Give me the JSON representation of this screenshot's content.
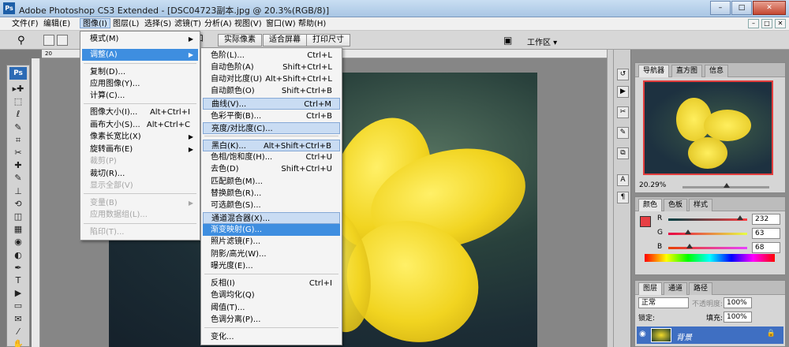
{
  "window": {
    "title": "Adobe Photoshop CS3 Extended - [DSC04723副本.jpg @ 20.3%(RGB/8)]",
    "app_badge": "Ps",
    "minimize": "–",
    "maximize": "□",
    "close": "✕"
  },
  "menubar": {
    "items": [
      "文件(F)",
      "编辑(E)",
      "图像(I)",
      "图层(L)",
      "选择(S)",
      "滤镜(T)",
      "分析(A)",
      "视图(V)",
      "窗口(W)",
      "帮助(H)"
    ],
    "active_index": 2,
    "doc_controls": [
      "–",
      "□",
      "✕"
    ]
  },
  "options_bar": {
    "tool_icon": "magnifier-icon",
    "buttons": [
      "实际像素",
      "适合屏幕",
      "打印尺寸"
    ],
    "partial_label": "口",
    "workspace": "工作区 ▾"
  },
  "toolbox": {
    "badge": "Ps",
    "tools": [
      "move-icon",
      "marquee-icon",
      "lasso-icon",
      "quick-select-icon",
      "crop-icon",
      "slice-icon",
      "healing-icon",
      "brush-icon",
      "clone-stamp-icon",
      "history-brush-icon",
      "eraser-icon",
      "gradient-icon",
      "blur-icon",
      "dodge-icon",
      "pen-icon",
      "type-icon",
      "path-select-icon",
      "shape-icon",
      "notes-icon",
      "eyedropper-icon",
      "hand-icon"
    ],
    "glyphs": [
      "▸✚",
      "⬚",
      "ℓ",
      "✎",
      "⌗",
      "✂",
      "✚",
      "✎",
      "⊥",
      "⟲",
      "◫",
      "▦",
      "◉",
      "◐",
      "✒",
      "T",
      "▶",
      "▭",
      "✉",
      "⁄",
      "✋"
    ]
  },
  "ruler": {
    "labels": [
      "20",
      "0"
    ]
  },
  "image_menu": {
    "items": [
      {
        "label": "模式(M)",
        "shortcut": "",
        "submenu": true,
        "disabled": false
      },
      {
        "label": "调整(A)",
        "shortcut": "",
        "submenu": true,
        "disabled": false,
        "selected": true
      },
      {
        "label": "复制(D)...",
        "shortcut": "",
        "disabled": false
      },
      {
        "label": "应用图像(Y)...",
        "shortcut": "",
        "disabled": false
      },
      {
        "label": "计算(C)...",
        "shortcut": "",
        "disabled": false
      },
      {
        "label": "图像大小(I)...",
        "shortcut": "Alt+Ctrl+I",
        "disabled": false
      },
      {
        "label": "画布大小(S)...",
        "shortcut": "Alt+Ctrl+C",
        "disabled": false
      },
      {
        "label": "像素长宽比(X)",
        "shortcut": "",
        "submenu": true,
        "disabled": false
      },
      {
        "label": "旋转画布(E)",
        "shortcut": "",
        "submenu": true,
        "disabled": false
      },
      {
        "label": "裁剪(P)",
        "shortcut": "",
        "disabled": true
      },
      {
        "label": "裁切(R)...",
        "shortcut": "",
        "disabled": false
      },
      {
        "label": "显示全部(V)",
        "shortcut": "",
        "disabled": true
      },
      {
        "label": "变量(B)",
        "shortcut": "",
        "submenu": true,
        "disabled": true
      },
      {
        "label": "应用数据组(L)...",
        "shortcut": "",
        "disabled": true
      },
      {
        "label": "陷印(T)...",
        "shortcut": "",
        "disabled": true
      }
    ]
  },
  "adjust_menu": {
    "items": [
      {
        "label": "色阶(L)...",
        "shortcut": "Ctrl+L"
      },
      {
        "label": "自动色阶(A)",
        "shortcut": "Shift+Ctrl+L"
      },
      {
        "label": "自动对比度(U)",
        "shortcut": "Alt+Shift+Ctrl+L"
      },
      {
        "label": "自动颜色(O)",
        "shortcut": "Shift+Ctrl+B"
      },
      {
        "label": "曲线(V)...",
        "shortcut": "Ctrl+M",
        "highlight": true
      },
      {
        "label": "色彩平衡(B)...",
        "shortcut": "Ctrl+B"
      },
      {
        "label": "亮度/对比度(C)...",
        "shortcut": "",
        "highlight": true
      },
      {
        "label": "黑白(K)...",
        "shortcut": "Alt+Shift+Ctrl+B",
        "highlight": true
      },
      {
        "label": "色相/饱和度(H)...",
        "shortcut": "Ctrl+U"
      },
      {
        "label": "去色(D)",
        "shortcut": "Shift+Ctrl+U"
      },
      {
        "label": "匹配颜色(M)...",
        "shortcut": ""
      },
      {
        "label": "替换颜色(R)...",
        "shortcut": ""
      },
      {
        "label": "可选颜色(S)...",
        "shortcut": ""
      },
      {
        "label": "通道混合器(X)...",
        "shortcut": "",
        "highlight": true
      },
      {
        "label": "渐变映射(G)...",
        "shortcut": "",
        "selected": true
      },
      {
        "label": "照片滤镜(F)...",
        "shortcut": ""
      },
      {
        "label": "阴影/高光(W)...",
        "shortcut": ""
      },
      {
        "label": "曝光度(E)...",
        "shortcut": ""
      },
      {
        "label": "反相(I)",
        "shortcut": "Ctrl+I"
      },
      {
        "label": "色调均化(Q)",
        "shortcut": ""
      },
      {
        "label": "阈值(T)...",
        "shortcut": ""
      },
      {
        "label": "色调分离(P)...",
        "shortcut": ""
      },
      {
        "label": "变化...",
        "shortcut": ""
      }
    ]
  },
  "navigator": {
    "tabs": [
      "导航器",
      "直方图",
      "信息"
    ],
    "zoom": "20.29%"
  },
  "color_panel": {
    "tabs": [
      "颜色",
      "色板",
      "样式"
    ],
    "channels": [
      {
        "name": "R",
        "value": "232",
        "fraction": 0.91
      },
      {
        "name": "G",
        "value": "63",
        "fraction": 0.25
      },
      {
        "name": "B",
        "value": "68",
        "fraction": 0.27
      }
    ],
    "foreground": "#e83f44",
    "background": "#000000"
  },
  "layers_panel": {
    "tabs": [
      "图层",
      "通道",
      "路径"
    ],
    "blend_mode": "正常",
    "opacity_label": "不透明度:",
    "opacity_value": "100%",
    "lock_label": "锁定:",
    "fill_label": "填充:",
    "fill_value": "100%",
    "layer_name": "背景"
  },
  "colors": {
    "accent_select": "#3e8ee0",
    "hover": "#c9dcf3",
    "title_gradient_top": "#c9def2"
  }
}
